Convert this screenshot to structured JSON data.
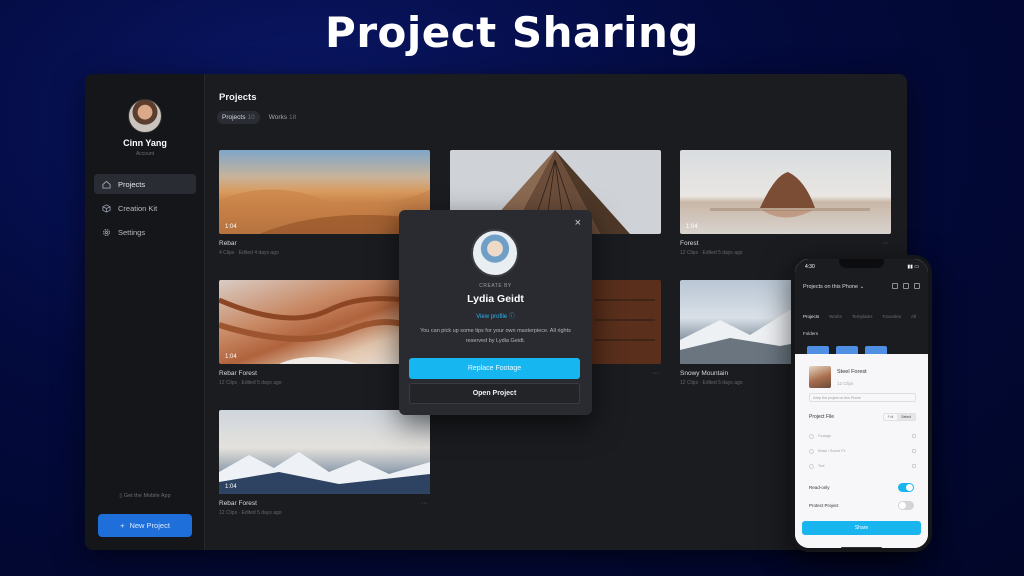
{
  "headline": "Project Sharing",
  "colors": {
    "accent": "#16b6f1",
    "primary_button": "#1e6fd9",
    "window_bg": "#1b1c20",
    "traffic_red": "#ff5f57",
    "traffic_yellow": "#febc2e",
    "traffic_green": "#28c840"
  },
  "sidebar": {
    "user_name": "Cinn Yang",
    "user_sub": "Account",
    "items": [
      {
        "label": "Projects",
        "icon": "home-icon"
      },
      {
        "label": "Creation Kit",
        "icon": "cube-icon"
      },
      {
        "label": "Settings",
        "icon": "gear-icon"
      }
    ],
    "mobile_app": "Get the Mobile App",
    "new_project": "New Project"
  },
  "main": {
    "title": "Projects",
    "tabs": [
      {
        "label": "Projects",
        "count": "10"
      },
      {
        "label": "Works",
        "count": "18"
      }
    ],
    "cards": [
      {
        "title": "Rebar",
        "duration": "1:04",
        "meta": "4 Clips · Edited 4 days ago"
      },
      {
        "title": "",
        "duration": "",
        "meta": ""
      },
      {
        "title": "Forest",
        "duration": "1:04",
        "meta": "12 Clips · Edited 5 days ago"
      },
      {
        "title": "Rebar Forest",
        "duration": "1:04",
        "meta": "12 Clips · Edited 5 days ago"
      },
      {
        "title": "",
        "duration": "",
        "meta": ""
      },
      {
        "title": "Snowy Mountain",
        "duration": "",
        "meta": "12 Clips · Edited 5 days ago"
      },
      {
        "title": "Rebar Forest",
        "duration": "1:04",
        "meta": "12 Clips · Edited 5 days ago"
      }
    ]
  },
  "modal": {
    "close": "×",
    "create_by": "CREATE BY",
    "creator": "Lydia Geidt",
    "view_profile": "View profile",
    "description": "You can pick up some tips for your own masterpiece. All rights reserved by Lydia Geidt.",
    "replace_button": "Replace Footage",
    "open_button": "Open Project"
  },
  "phone": {
    "time": "4:30",
    "header": "Projects on this Phone",
    "tabs": [
      "Projects",
      "Works",
      "Templates",
      "Favorites",
      "All"
    ],
    "folders": "Folders",
    "sheet": {
      "project_name": "Steel Forest",
      "project_meta": "12 Clips",
      "select": "Keep the project on this Phone",
      "file_label": "Project File",
      "seg": [
        "Full",
        "Select"
      ],
      "rows": [
        "Footage",
        "Music / Sound FX",
        "Text"
      ],
      "readonly_label": "Read-only",
      "protect_label": "Protect Project",
      "readonly_on": true,
      "protect_on": false,
      "share": "Share"
    }
  }
}
